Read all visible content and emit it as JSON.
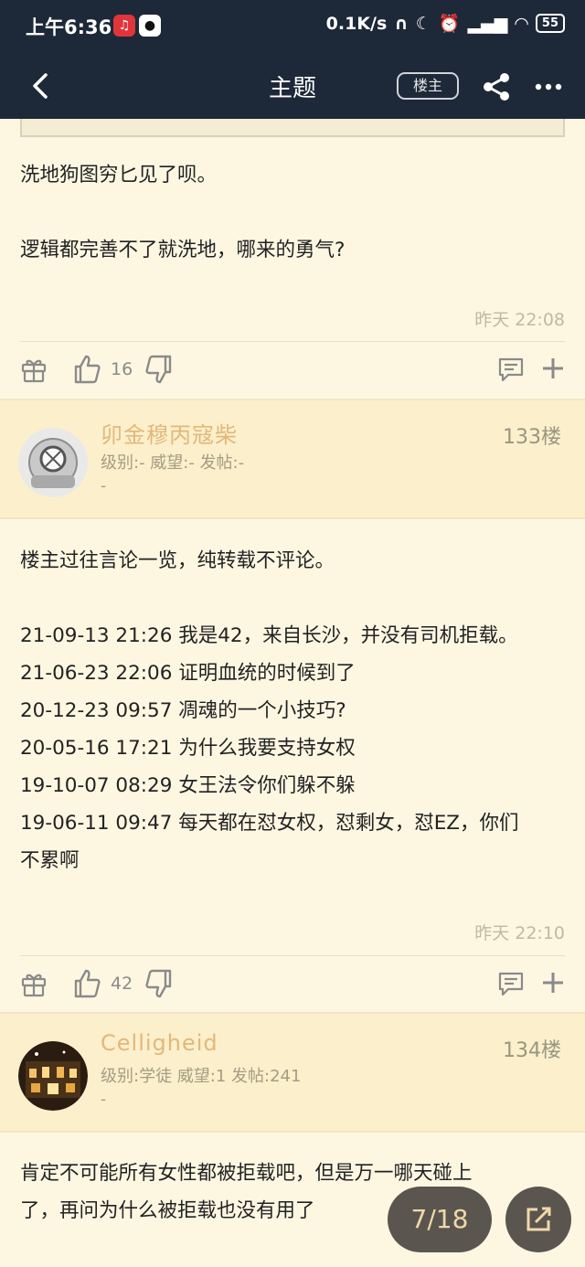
{
  "status": {
    "time": "上午6:36",
    "net_speed": "0.1K/s",
    "battery": "55"
  },
  "nav": {
    "title": "主题",
    "op_tag": "楼主"
  },
  "post_prev": {
    "lines": [
      "洗地狗图穷匕见了呗。",
      "",
      "逻辑都完善不了就洗地，哪来的勇气?"
    ],
    "timestamp": "昨天 22:08",
    "likes": "16"
  },
  "post_133": {
    "username": "卯金穆丙寇柴",
    "meta": "级别:- 威望:- 发帖:-",
    "signature": "-",
    "floor": "133楼",
    "lines": [
      "楼主过往言论一览，纯转载不评论。",
      "",
      "21-09-13 21:26 我是42，来自长沙，并没有司机拒载。",
      "21-06-23 22:06 证明血统的时候到了",
      "20-12-23 09:57 凋魂的一个小技巧?",
      "20-05-16 17:21 为什么我要支持女权",
      "19-10-07 08:29 女王法令你们躲不躲",
      "19-06-11 09:47 每天都在怼女权，怼剩女，怼EZ，你们",
      "不累啊"
    ],
    "timestamp": "昨天 22:10",
    "likes": "42"
  },
  "post_134": {
    "username": "Celligheid",
    "meta": "级别:学徒 威望:1 发帖:241",
    "signature": "-",
    "floor": "134楼",
    "lines": [
      "肯定不可能所有女性都被拒载吧，但是万一哪天碰上",
      "了，再问为什么被拒载也没有用了"
    ]
  },
  "pager": {
    "label": "7/18"
  },
  "colors": {
    "nav_bg": "#1d2838",
    "page_bg": "#fdf7e2",
    "username": "#e3b77c",
    "fab_bg": "#5b5550"
  }
}
